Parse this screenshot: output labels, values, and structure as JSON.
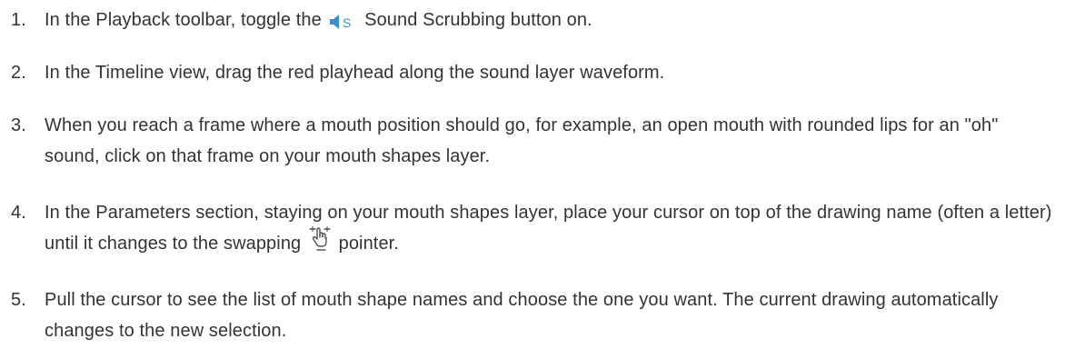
{
  "steps": [
    {
      "number": "1.",
      "before": "In the Playback toolbar, toggle the ",
      "icon": "sound-scrubbing-icon",
      "after": " Sound Scrubbing button on."
    },
    {
      "number": "2.",
      "text": "In the Timeline view, drag the red playhead along the sound layer waveform."
    },
    {
      "number": "3.",
      "text": "When you reach a frame where a mouth position should go, for example, an open mouth with rounded lips for an \"oh\" sound, click on that frame on your mouth shapes layer."
    },
    {
      "number": "4.",
      "before": "In the Parameters section, staying on your mouth shapes layer, place your cursor on top of the drawing name (often a letter) until it changes to the swapping ",
      "icon": "swap-pointer-icon",
      "after": " pointer."
    },
    {
      "number": "5.",
      "text": "Pull the cursor to see the list of mouth shape names and choose the one you want. The current drawing automatically changes to the new selection."
    }
  ],
  "colors": {
    "text": "#333333",
    "speaker_icon": "#3c8fd6",
    "hand_icon": "#555555"
  }
}
